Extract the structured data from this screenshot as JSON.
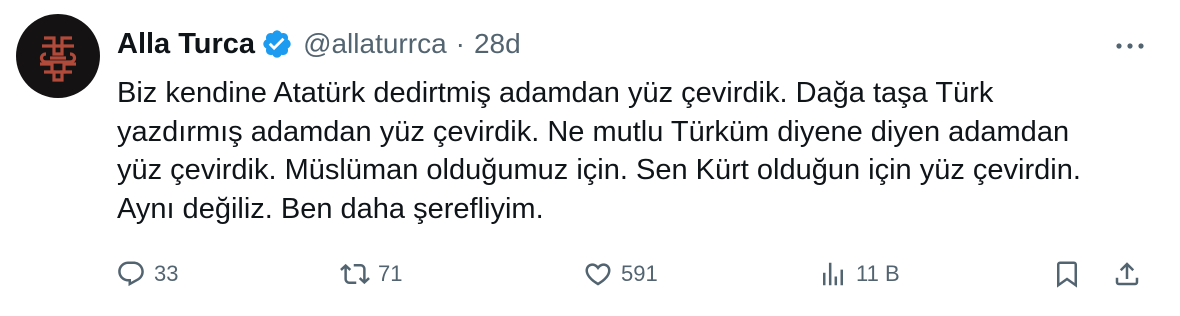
{
  "author": {
    "display_name": "Alla Turca",
    "handle": "@allaturrca",
    "separator": "·",
    "age": "28d",
    "avatar_icon": "ornamental-logo-icon",
    "verified_icon": "verified-badge-icon",
    "verified_color": "#1d9bf0"
  },
  "tweet": {
    "lines": [
      "Biz kendine Atatürk dedirtmiş adamdan yüz çevirdik. Dağa taşa Türk",
      "yazdırmış adamdan yüz çevirdik. Ne mutlu Türküm diyene diyen adamdan",
      "yüz çevirdik. Müslüman olduğumuz için. Sen Kürt olduğun için yüz çevirdin.",
      "Aynı değiliz. Ben daha şerefliyim."
    ]
  },
  "actions": {
    "replies": {
      "icon": "reply-icon",
      "count": "33"
    },
    "reposts": {
      "icon": "repost-icon",
      "count": "71"
    },
    "likes": {
      "icon": "heart-icon",
      "count": "591"
    },
    "views": {
      "icon": "views-icon",
      "count": "11 B"
    },
    "bookmark": {
      "icon": "bookmark-icon"
    },
    "share": {
      "icon": "share-icon"
    }
  },
  "colors": {
    "text": "#0f1419",
    "secondary": "#536471",
    "avatar_bg": "#141212",
    "avatar_accent": "#b14a3a"
  }
}
